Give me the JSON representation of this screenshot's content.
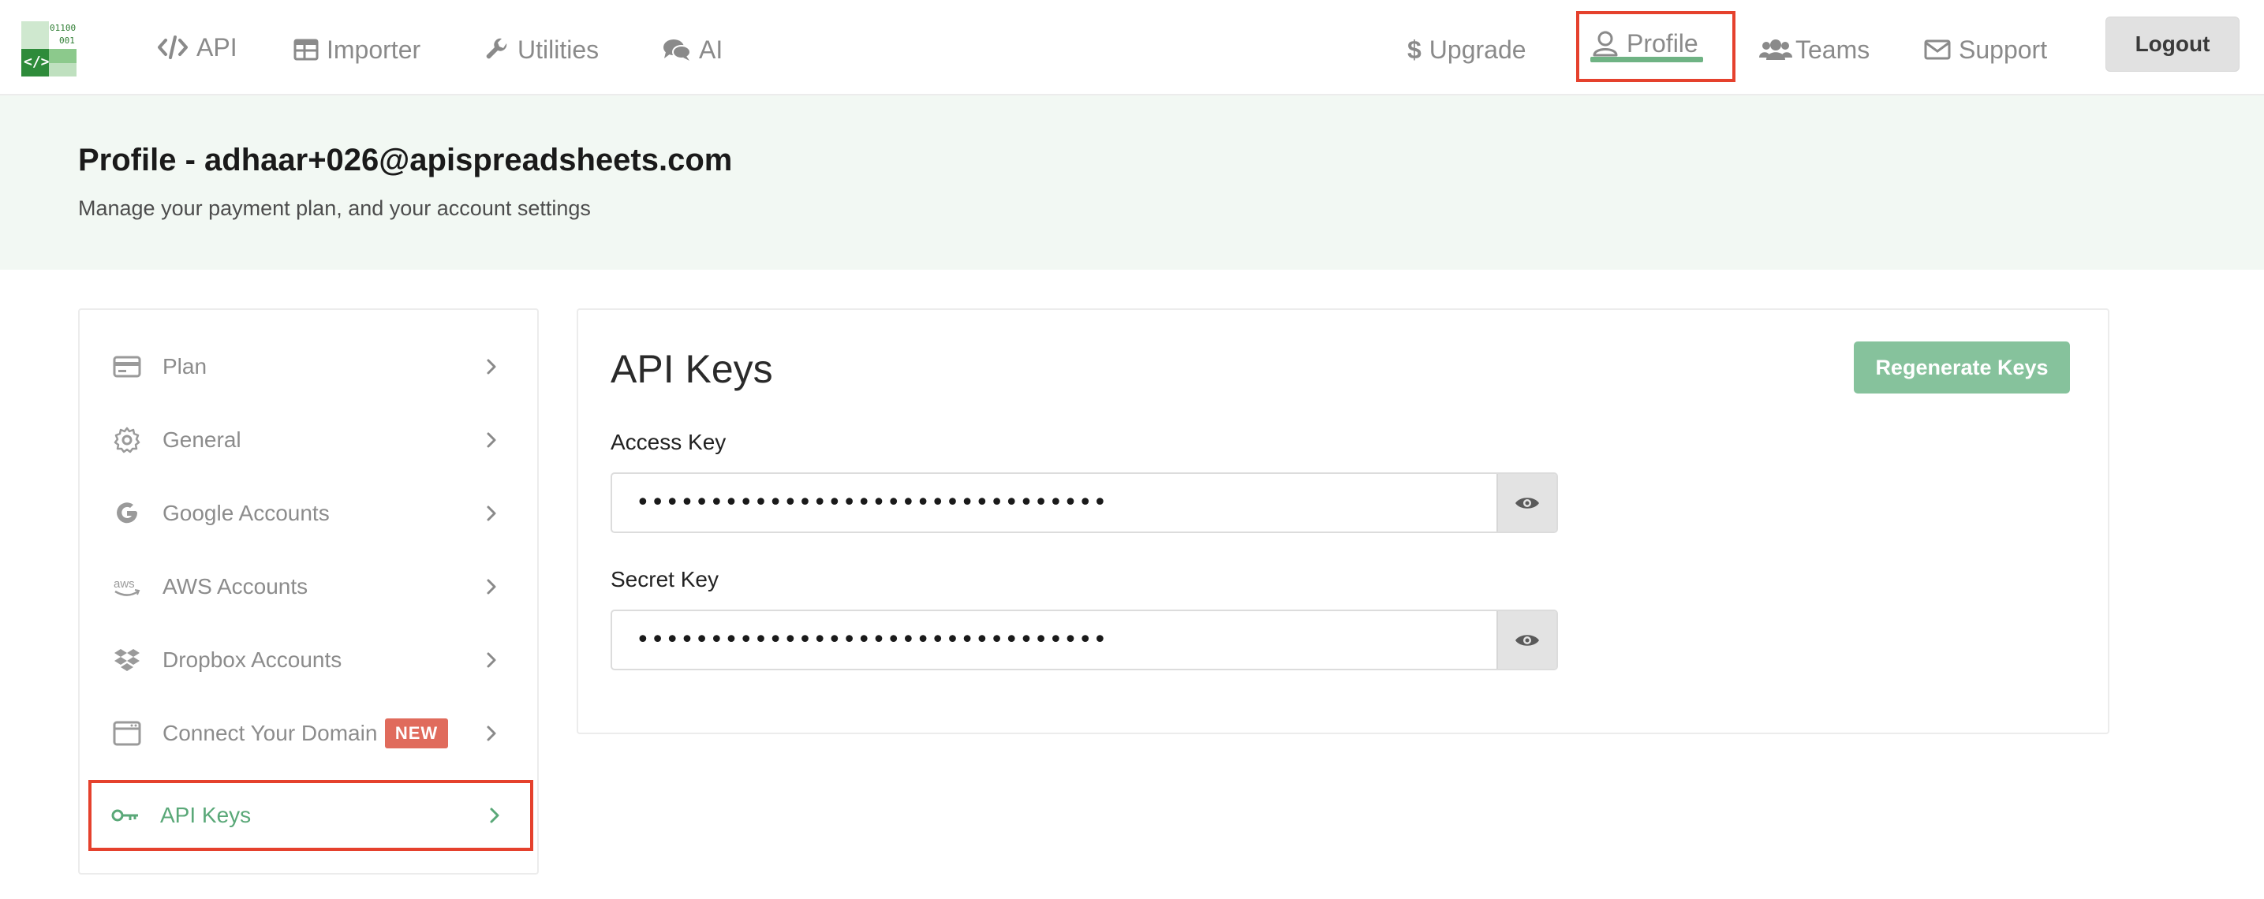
{
  "logo": {
    "code_line1": "01100",
    "code_line2": "001",
    "glyph": "</>"
  },
  "nav": {
    "api": "API",
    "importer": "Importer",
    "utilities": "Utilities",
    "ai": "AI",
    "upgrade": "Upgrade",
    "profile": "Profile",
    "teams": "Teams",
    "support": "Support",
    "logout": "Logout"
  },
  "header": {
    "title": "Profile - adhaar+026@apispreadsheets.com",
    "subtitle": "Manage your payment plan, and your account settings"
  },
  "sidebar": {
    "items": [
      {
        "label": "Plan",
        "icon": "credit-card-icon"
      },
      {
        "label": "General",
        "icon": "gear-icon"
      },
      {
        "label": "Google Accounts",
        "icon": "google-icon"
      },
      {
        "label": "AWS Accounts",
        "icon": "aws-icon"
      },
      {
        "label": "Dropbox Accounts",
        "icon": "dropbox-icon"
      },
      {
        "label": "Connect Your Domain",
        "icon": "browser-window-icon",
        "badge": "NEW"
      },
      {
        "label": "API Keys",
        "icon": "key-icon",
        "active": true
      }
    ]
  },
  "main": {
    "title": "API Keys",
    "regenerate_label": "Regenerate Keys",
    "access_key_label": "Access Key",
    "access_key_value": "••••••••••••••••••••••••••••••••",
    "secret_key_label": "Secret Key",
    "secret_key_value": "••••••••••••••••••••••••••••••••"
  },
  "colors": {
    "accent_green": "#86c29c",
    "active_green": "#5aa878",
    "highlight_red": "#e5412d",
    "new_badge": "#e06b5c",
    "header_band": "#f2f8f3"
  }
}
